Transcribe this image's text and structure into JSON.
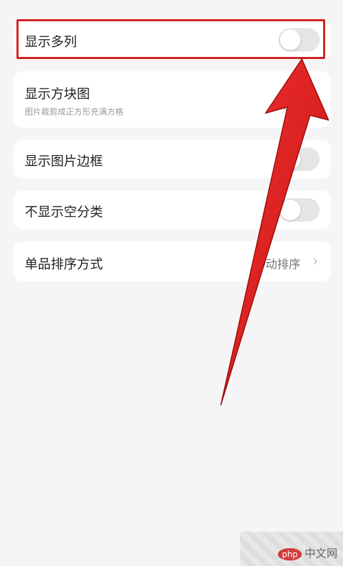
{
  "settings": {
    "items": [
      {
        "label": "显示多列",
        "type": "toggle",
        "on": false
      },
      {
        "label": "显示方块图",
        "sublabel": "图片裁剪成正方形充满方格",
        "type": "toggle",
        "on": false
      },
      {
        "label": "显示图片边框",
        "type": "toggle",
        "on": false
      },
      {
        "label": "不显示空分类",
        "type": "toggle",
        "on": false
      },
      {
        "label": "单品排序方式",
        "type": "select",
        "value": "手动排序"
      }
    ]
  },
  "watermark": {
    "logo": "php",
    "text": "中文网"
  },
  "colors": {
    "background": "#f5f5f5",
    "card": "#ffffff",
    "toggle_off": "#e5e5e5",
    "highlight": "#d21e1e",
    "arrow": "#e01818"
  },
  "icons": {
    "chevron": "chevron-right-icon"
  }
}
